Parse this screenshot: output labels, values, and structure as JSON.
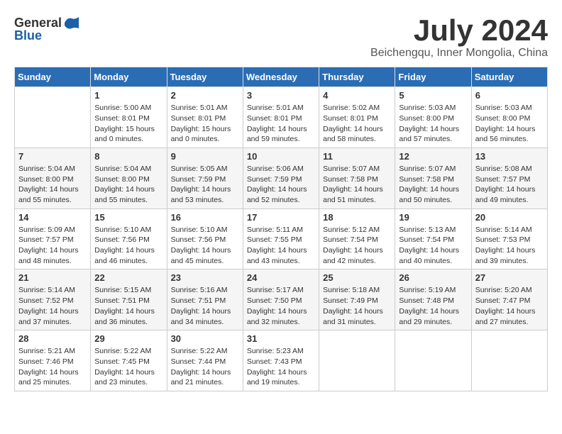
{
  "header": {
    "logo_general": "General",
    "logo_blue": "Blue",
    "month_title": "July 2024",
    "location": "Beichengqu, Inner Mongolia, China"
  },
  "calendar": {
    "columns": [
      "Sunday",
      "Monday",
      "Tuesday",
      "Wednesday",
      "Thursday",
      "Friday",
      "Saturday"
    ],
    "weeks": [
      [
        {
          "day": "",
          "info": ""
        },
        {
          "day": "1",
          "info": "Sunrise: 5:00 AM\nSunset: 8:01 PM\nDaylight: 15 hours\nand 0 minutes."
        },
        {
          "day": "2",
          "info": "Sunrise: 5:01 AM\nSunset: 8:01 PM\nDaylight: 15 hours\nand 0 minutes."
        },
        {
          "day": "3",
          "info": "Sunrise: 5:01 AM\nSunset: 8:01 PM\nDaylight: 14 hours\nand 59 minutes."
        },
        {
          "day": "4",
          "info": "Sunrise: 5:02 AM\nSunset: 8:01 PM\nDaylight: 14 hours\nand 58 minutes."
        },
        {
          "day": "5",
          "info": "Sunrise: 5:03 AM\nSunset: 8:00 PM\nDaylight: 14 hours\nand 57 minutes."
        },
        {
          "day": "6",
          "info": "Sunrise: 5:03 AM\nSunset: 8:00 PM\nDaylight: 14 hours\nand 56 minutes."
        }
      ],
      [
        {
          "day": "7",
          "info": "Sunrise: 5:04 AM\nSunset: 8:00 PM\nDaylight: 14 hours\nand 55 minutes."
        },
        {
          "day": "8",
          "info": "Sunrise: 5:04 AM\nSunset: 8:00 PM\nDaylight: 14 hours\nand 55 minutes."
        },
        {
          "day": "9",
          "info": "Sunrise: 5:05 AM\nSunset: 7:59 PM\nDaylight: 14 hours\nand 53 minutes."
        },
        {
          "day": "10",
          "info": "Sunrise: 5:06 AM\nSunset: 7:59 PM\nDaylight: 14 hours\nand 52 minutes."
        },
        {
          "day": "11",
          "info": "Sunrise: 5:07 AM\nSunset: 7:58 PM\nDaylight: 14 hours\nand 51 minutes."
        },
        {
          "day": "12",
          "info": "Sunrise: 5:07 AM\nSunset: 7:58 PM\nDaylight: 14 hours\nand 50 minutes."
        },
        {
          "day": "13",
          "info": "Sunrise: 5:08 AM\nSunset: 7:57 PM\nDaylight: 14 hours\nand 49 minutes."
        }
      ],
      [
        {
          "day": "14",
          "info": "Sunrise: 5:09 AM\nSunset: 7:57 PM\nDaylight: 14 hours\nand 48 minutes."
        },
        {
          "day": "15",
          "info": "Sunrise: 5:10 AM\nSunset: 7:56 PM\nDaylight: 14 hours\nand 46 minutes."
        },
        {
          "day": "16",
          "info": "Sunrise: 5:10 AM\nSunset: 7:56 PM\nDaylight: 14 hours\nand 45 minutes."
        },
        {
          "day": "17",
          "info": "Sunrise: 5:11 AM\nSunset: 7:55 PM\nDaylight: 14 hours\nand 43 minutes."
        },
        {
          "day": "18",
          "info": "Sunrise: 5:12 AM\nSunset: 7:54 PM\nDaylight: 14 hours\nand 42 minutes."
        },
        {
          "day": "19",
          "info": "Sunrise: 5:13 AM\nSunset: 7:54 PM\nDaylight: 14 hours\nand 40 minutes."
        },
        {
          "day": "20",
          "info": "Sunrise: 5:14 AM\nSunset: 7:53 PM\nDaylight: 14 hours\nand 39 minutes."
        }
      ],
      [
        {
          "day": "21",
          "info": "Sunrise: 5:14 AM\nSunset: 7:52 PM\nDaylight: 14 hours\nand 37 minutes."
        },
        {
          "day": "22",
          "info": "Sunrise: 5:15 AM\nSunset: 7:51 PM\nDaylight: 14 hours\nand 36 minutes."
        },
        {
          "day": "23",
          "info": "Sunrise: 5:16 AM\nSunset: 7:51 PM\nDaylight: 14 hours\nand 34 minutes."
        },
        {
          "day": "24",
          "info": "Sunrise: 5:17 AM\nSunset: 7:50 PM\nDaylight: 14 hours\nand 32 minutes."
        },
        {
          "day": "25",
          "info": "Sunrise: 5:18 AM\nSunset: 7:49 PM\nDaylight: 14 hours\nand 31 minutes."
        },
        {
          "day": "26",
          "info": "Sunrise: 5:19 AM\nSunset: 7:48 PM\nDaylight: 14 hours\nand 29 minutes."
        },
        {
          "day": "27",
          "info": "Sunrise: 5:20 AM\nSunset: 7:47 PM\nDaylight: 14 hours\nand 27 minutes."
        }
      ],
      [
        {
          "day": "28",
          "info": "Sunrise: 5:21 AM\nSunset: 7:46 PM\nDaylight: 14 hours\nand 25 minutes."
        },
        {
          "day": "29",
          "info": "Sunrise: 5:22 AM\nSunset: 7:45 PM\nDaylight: 14 hours\nand 23 minutes."
        },
        {
          "day": "30",
          "info": "Sunrise: 5:22 AM\nSunset: 7:44 PM\nDaylight: 14 hours\nand 21 minutes."
        },
        {
          "day": "31",
          "info": "Sunrise: 5:23 AM\nSunset: 7:43 PM\nDaylight: 14 hours\nand 19 minutes."
        },
        {
          "day": "",
          "info": ""
        },
        {
          "day": "",
          "info": ""
        },
        {
          "day": "",
          "info": ""
        }
      ]
    ]
  }
}
